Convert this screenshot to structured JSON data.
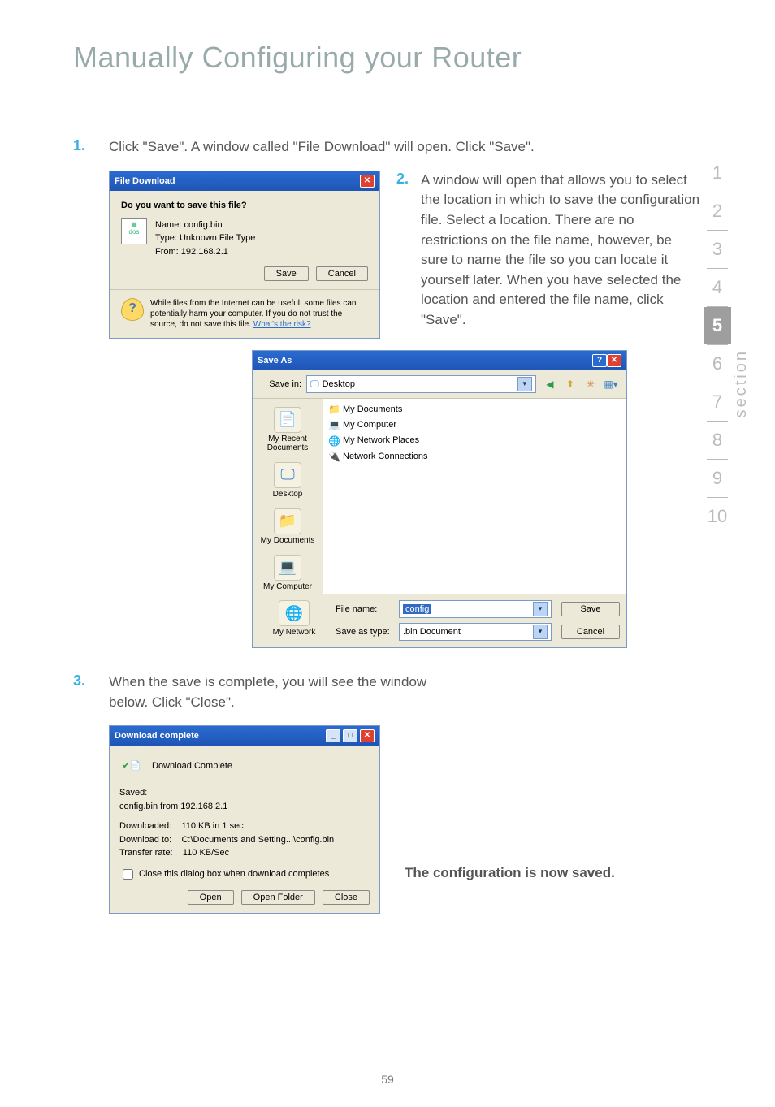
{
  "page": {
    "title": "Manually Configuring your Router",
    "number": "59"
  },
  "section": {
    "word": "section",
    "items": [
      "1",
      "2",
      "3",
      "4",
      "5",
      "6",
      "7",
      "8",
      "9",
      "10"
    ],
    "active": "5"
  },
  "steps": {
    "s1_num": "1.",
    "s1_text": "Click \"Save\". A window called \"File Download\" will open. Click \"Save\".",
    "s2_num": "2.",
    "s2_text": "A window will open that allows you to select the location in which to save the configuration file. Select a location. There are no restrictions on the file name, however, be sure to name the file so you can locate it yourself later. When you have selected the location and entered the file name, click \"Save\".",
    "s3_num": "3.",
    "s3_text": "When the save is complete, you will see the window below. Click \"Close\".",
    "saved_note": "The configuration is now saved."
  },
  "fileDownload": {
    "title": "File Download",
    "question": "Do you want to save this file?",
    "name_lbl": "Name:",
    "name_val": "config.bin",
    "type_lbl": "Type:",
    "type_val": "Unknown File Type",
    "from_lbl": "From:",
    "from_val": "192.168.2.1",
    "save": "Save",
    "cancel": "Cancel",
    "footer": "While files from the Internet can be useful, some files can potentially harm your computer. If you do not trust the source, do not save this file.",
    "risk": "What's the risk?"
  },
  "saveAs": {
    "title": "Save As",
    "savein_lbl": "Save in:",
    "savein_val": "Desktop",
    "list": {
      "a": "My Documents",
      "b": "My Computer",
      "c": "My Network Places",
      "d": "Network Connections"
    },
    "places": {
      "recent": "My Recent Documents",
      "desktop": "Desktop",
      "mydocs": "My Documents",
      "mycomp": "My Computer",
      "mynet": "My Network"
    },
    "filename_lbl": "File name:",
    "filename_val": "config",
    "savetype_lbl": "Save as type:",
    "savetype_val": ".bin Document",
    "save": "Save",
    "cancel": "Cancel"
  },
  "downloadComplete": {
    "title": "Download complete",
    "head": "Download Complete",
    "saved_lbl": "Saved:",
    "saved_val": "config.bin from 192.168.2.1",
    "downloaded_lbl": "Downloaded:",
    "downloaded_val": "110 KB in 1 sec",
    "downloadto_lbl": "Download to:",
    "downloadto_val": "C:\\Documents and Setting...\\config.bin",
    "rate_lbl": "Transfer rate:",
    "rate_val": "110 KB/Sec",
    "chk": "Close this dialog box when download completes",
    "open": "Open",
    "openfolder": "Open Folder",
    "close": "Close"
  }
}
